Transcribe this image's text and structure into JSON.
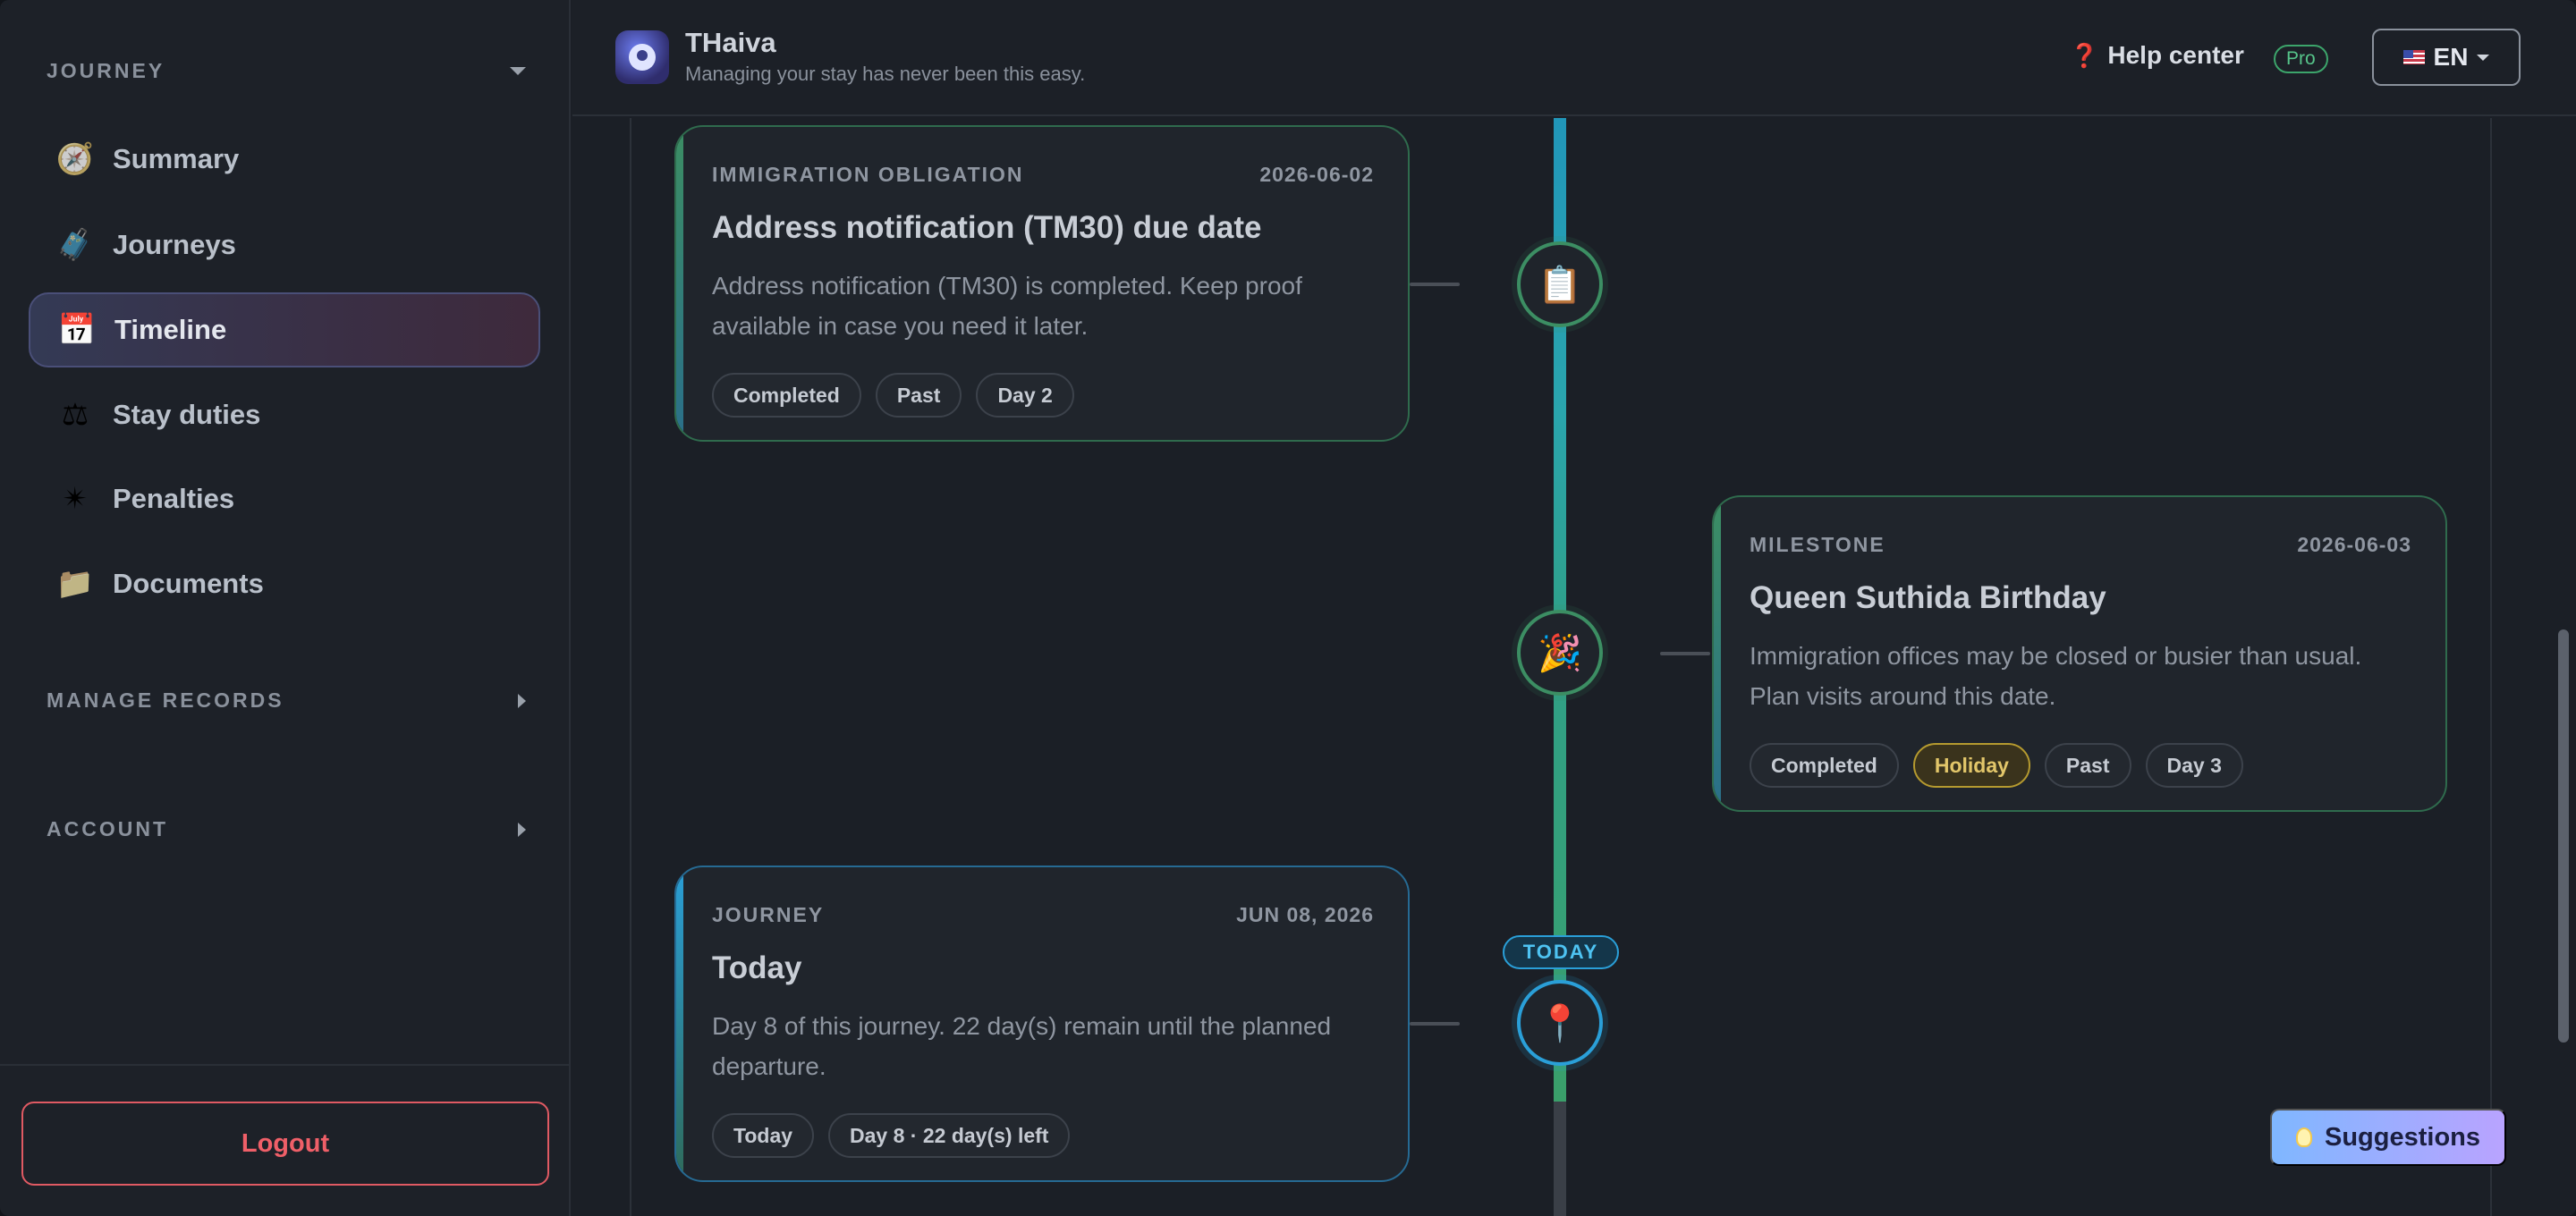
{
  "app": {
    "name": "THaiva",
    "tagline": "Managing your stay has never been this easy."
  },
  "header": {
    "help_label": "Help center",
    "help_icon": "question-mark-icon",
    "plan_badge": "Pro",
    "language": "EN",
    "language_flag": "us-flag-icon"
  },
  "sidebar": {
    "sections": [
      {
        "label": "JOURNEY",
        "expanded": true
      },
      {
        "label": "MANAGE RECORDS",
        "expanded": false
      },
      {
        "label": "ACCOUNT",
        "expanded": false
      }
    ],
    "items": [
      {
        "label": "Summary",
        "icon": "compass-icon",
        "active": false
      },
      {
        "label": "Journeys",
        "icon": "luggage-icon",
        "active": false
      },
      {
        "label": "Timeline",
        "icon": "calendar-icon",
        "active": true
      },
      {
        "label": "Stay duties",
        "icon": "scales-icon",
        "active": false
      },
      {
        "label": "Penalties",
        "icon": "alert-icon",
        "active": false
      },
      {
        "label": "Documents",
        "icon": "folder-icon",
        "active": false
      }
    ],
    "logout_label": "Logout"
  },
  "timeline": {
    "today_marker": "TODAY",
    "events": [
      {
        "kicker": "IMMIGRATION OBLIGATION",
        "date": "2026-06-02",
        "title": "Address notification (TM30) due date",
        "description": "Address notification (TM30) is completed. Keep proof available in case you need it later.",
        "chips": [
          "Completed",
          "Past",
          "Day 2"
        ],
        "node_icon": "clipboard-icon",
        "status_color": "#3c8e63"
      },
      {
        "kicker": "MILESTONE",
        "date": "2026-06-03",
        "title": "Queen Suthida Birthday",
        "description": "Immigration offices may be closed or busier than usual. Plan visits around this date.",
        "chips": [
          "Completed",
          "Holiday",
          "Past",
          "Day 3"
        ],
        "node_icon": "party-popper-icon",
        "status_color": "#3c8e63"
      },
      {
        "kicker": "JOURNEY",
        "date": "JUN 08, 2026",
        "title": "Today",
        "description": "Day 8 of this journey. 22 day(s) remain until the planned departure.",
        "chips": [
          "Today",
          "Day 8 · 22 day(s) left"
        ],
        "node_icon": "location-pin-icon",
        "status_color": "#2a9fd8"
      }
    ]
  },
  "suggestions": {
    "label": "Suggestions",
    "icon": "lightbulb-icon"
  },
  "colors": {
    "accent_blue": "#2a9fd8",
    "accent_green": "#3c8e63",
    "danger": "#e05a63",
    "holiday": "#b59a2f"
  }
}
